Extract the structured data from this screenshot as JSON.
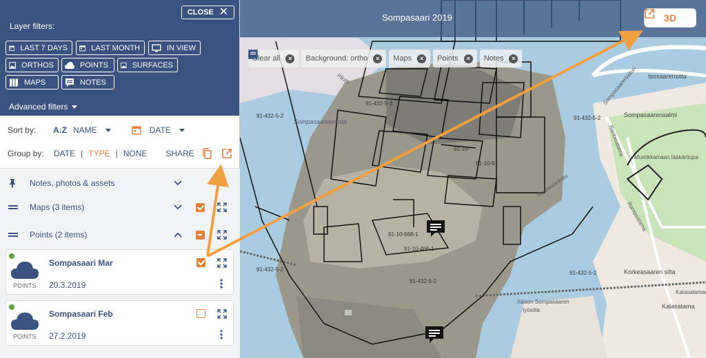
{
  "map": {
    "title": "Sompasaari 2019",
    "btn_3d": "3D",
    "chips": [
      {
        "label": "Clear all",
        "icon": "trash-icon"
      },
      {
        "label": "Background: ortho",
        "icon": "image-icon"
      },
      {
        "label": "Maps",
        "icon": "map-icon"
      },
      {
        "label": "Points",
        "icon": "cloud-icon"
      },
      {
        "label": "Notes",
        "icon": "note-icon"
      }
    ],
    "parcel_labels": [
      "91-432-5-2",
      "91-432-5-3",
      "91-10-",
      "91-10-9",
      "91-10-668-1",
      "91-10-466-1",
      "91-432-5-2",
      "91-432-5-2",
      "91-432-5-2",
      "91-432-5-2"
    ],
    "place_labels": [
      "Isosaarensilta",
      "Sompasaarensalmi",
      "Korkeasaaren silta",
      "Kalasatama",
      "Sompasaarenranta",
      "Saukkolankatu"
    ],
    "road_labels": [
      "Rantasatama",
      "Sompasaarenlaituri",
      "Mustikkamaan lääkäritupa",
      "Rantasatama",
      "Kalasataman"
    ],
    "extra_labels": [
      "Sompasaari",
      "Pilotti",
      "Itäisen Sompasaaren",
      "työsilta"
    ]
  },
  "panel": {
    "close_label": "CLOSE",
    "layer_filters_label": "Layer filters:",
    "filters": [
      {
        "label": "LAST 7 DAYS",
        "icon": "calendar-icon",
        "selected": false
      },
      {
        "label": "LAST MONTH",
        "icon": "calendar-icon",
        "selected": false
      },
      {
        "label": "IN VIEW",
        "icon": "monitor-icon",
        "selected": false
      },
      {
        "label": "ORTHOS",
        "icon": "image-icon",
        "selected": false
      },
      {
        "label": "POINTS",
        "icon": "cloud-icon",
        "selected": false
      },
      {
        "label": "SURFACES",
        "icon": "image-icon",
        "selected": false
      },
      {
        "label": "MAPS",
        "icon": "map-icon",
        "selected": false
      },
      {
        "label": "NOTES",
        "icon": "note-icon",
        "selected": false
      }
    ],
    "advanced_filters": "Advanced filters",
    "sort_by_label": "Sort by:",
    "sort_name": "NAME",
    "sort_date": "DATE",
    "group_by_label": "Group by:",
    "group_options": [
      "DATE",
      "TYPE",
      "NONE"
    ],
    "group_active": "TYPE",
    "share_label": "SHARE",
    "groups": [
      {
        "label": "Notes, photos & assets",
        "expanded": false
      },
      {
        "label": "Maps (3 items)",
        "expanded": false,
        "checked": true
      },
      {
        "label": "Points (2 items)",
        "expanded": true,
        "checked": "indeterminate"
      }
    ],
    "items": [
      {
        "name": "Sompasaari Mar",
        "type": "POINTS",
        "date": "20.3.2019",
        "checked": true
      },
      {
        "name": "Sompasaari Feb",
        "type": "POINTS",
        "date": "27.2.2019",
        "checked": false
      }
    ],
    "colors": {
      "header": "#3a5280",
      "accent": "#e8803a",
      "status": "#5aa637"
    }
  }
}
